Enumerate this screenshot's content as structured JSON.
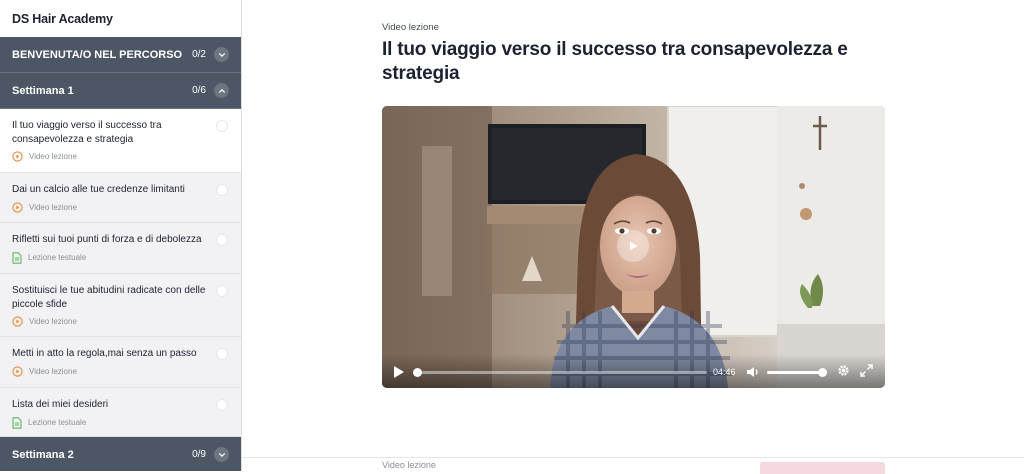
{
  "sidebar": {
    "brand": "DS Hair Academy",
    "intro": {
      "title": "BENVENUTA/O NEL PERCORSO",
      "count": "0/2"
    },
    "week1": {
      "title": "Settimana 1",
      "count": "0/6"
    },
    "lessons": [
      {
        "title": "Il tuo viaggio verso il successo tra consapevolezza e strategia",
        "type": "Video lezione"
      },
      {
        "title": "Dai un calcio alle tue credenze limitanti",
        "type": "Video lezione"
      },
      {
        "title": "Rifletti sui tuoi punti di forza e di debolezza",
        "type": "Lezione testuale"
      },
      {
        "title": "Sostituisci le tue abitudini radicate con delle piccole sfide",
        "type": "Video lezione"
      },
      {
        "title": "Metti in atto la regola,mai senza un passo",
        "type": "Video lezione"
      },
      {
        "title": "Lista dei miei desideri",
        "type": "Lezione testuale"
      }
    ],
    "week2": {
      "title": "Settimana 2",
      "count": "0/9"
    }
  },
  "main": {
    "kicker": "Video lezione",
    "title": "Il tuo viaggio verso il successo tra consapevolezza e strategia",
    "video": {
      "duration": "04:46",
      "progress": 0.0,
      "volume": 0.95
    },
    "next_kicker": "Video lezione"
  },
  "colors": {
    "section_bg": "#4c5664",
    "video_icon": "#e48a3c",
    "text_icon": "#5bb75b",
    "accent_pink": "#f5d9de"
  },
  "icons": [
    "chevron-down-icon",
    "chevron-up-icon",
    "play-circle-icon",
    "document-icon",
    "play-icon",
    "volume-icon",
    "settings-icon",
    "fullscreen-icon"
  ]
}
